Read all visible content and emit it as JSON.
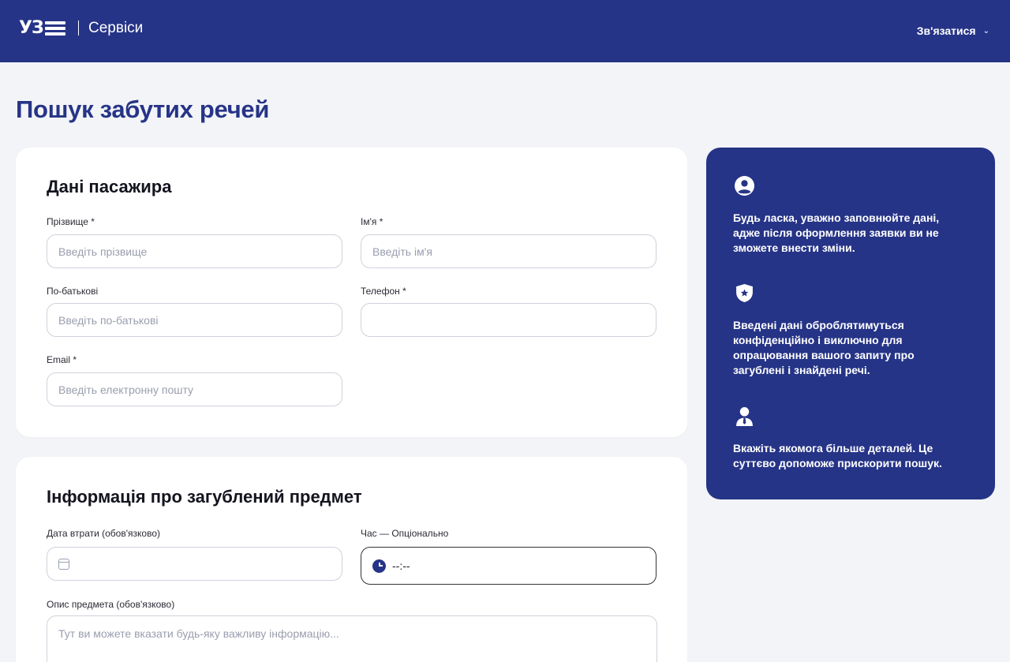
{
  "header": {
    "logo_text": "УЗ",
    "brand_sub": "Сервіси",
    "contact_label": "Зв'язатися",
    "contact_chevron": "⌄"
  },
  "page": {
    "title": "Пошук забутих речей"
  },
  "passenger": {
    "title": "Дані пасажира",
    "surname": {
      "label": "Прізвище *",
      "placeholder": "Введіть прізвище"
    },
    "name": {
      "label": "Ім'я *",
      "placeholder": "Введіть ім'я"
    },
    "patronymic": {
      "label": "По-батькові",
      "placeholder": "Введіть по-батькові"
    },
    "phone": {
      "label": "Телефон *",
      "placeholder": ""
    },
    "email": {
      "label": "Email *",
      "placeholder": "Введіть електронну пошту"
    }
  },
  "item": {
    "title": "Інформація про загублений предмет",
    "date": {
      "label": "Дата втрати (обов'язково)",
      "value": ""
    },
    "time": {
      "label": "Час — Опціонально",
      "value": "--:--"
    },
    "description": {
      "label": "Опис предмета (обов'язково)",
      "placeholder": "Тут ви можете вказати будь-яку важливу інформацію..."
    }
  },
  "info": {
    "items": [
      {
        "icon": "user-circle-icon",
        "text": "Будь ласка, уважно заповнюйте дані, адже після оформлення заявки ви не зможете внести зміни."
      },
      {
        "icon": "shield-star-icon",
        "text": "Введені дані оброблятимуться конфіденційно і виключно для опрацювання вашого запиту про загублені і знайдені речі."
      },
      {
        "icon": "person-tie-icon",
        "text": "Вкажіть якомога більше деталей. Це суттєво допоможе прискорити пошук."
      }
    ]
  },
  "colors": {
    "brand": "#263487",
    "background": "#f3f4f7",
    "card": "#ffffff",
    "input_border": "#cfd2dc"
  }
}
